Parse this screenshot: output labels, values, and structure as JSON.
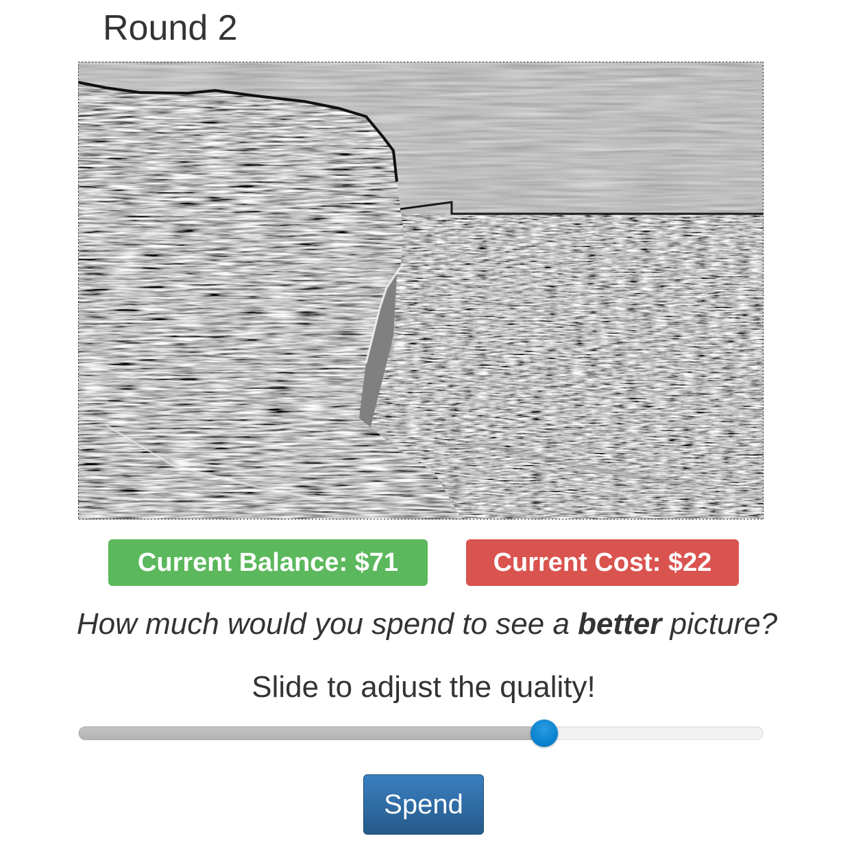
{
  "round": {
    "title": "Round 2"
  },
  "image": {
    "alt": "Distorted grayscale photo"
  },
  "badges": {
    "balance": "Current Balance: $71",
    "cost": "Current Cost: $22"
  },
  "question": {
    "prefix": "How much would you spend to see a ",
    "emphasis": "better",
    "suffix": " picture?"
  },
  "slider": {
    "label": "Slide to adjust the quality!",
    "value_fraction": 0.68
  },
  "actions": {
    "spend_label": "Spend"
  },
  "colors": {
    "balance_badge": "#5cb85c",
    "cost_badge": "#d9534f",
    "spend_button": "#337ab7",
    "slider_handle": "#0a83d0"
  }
}
